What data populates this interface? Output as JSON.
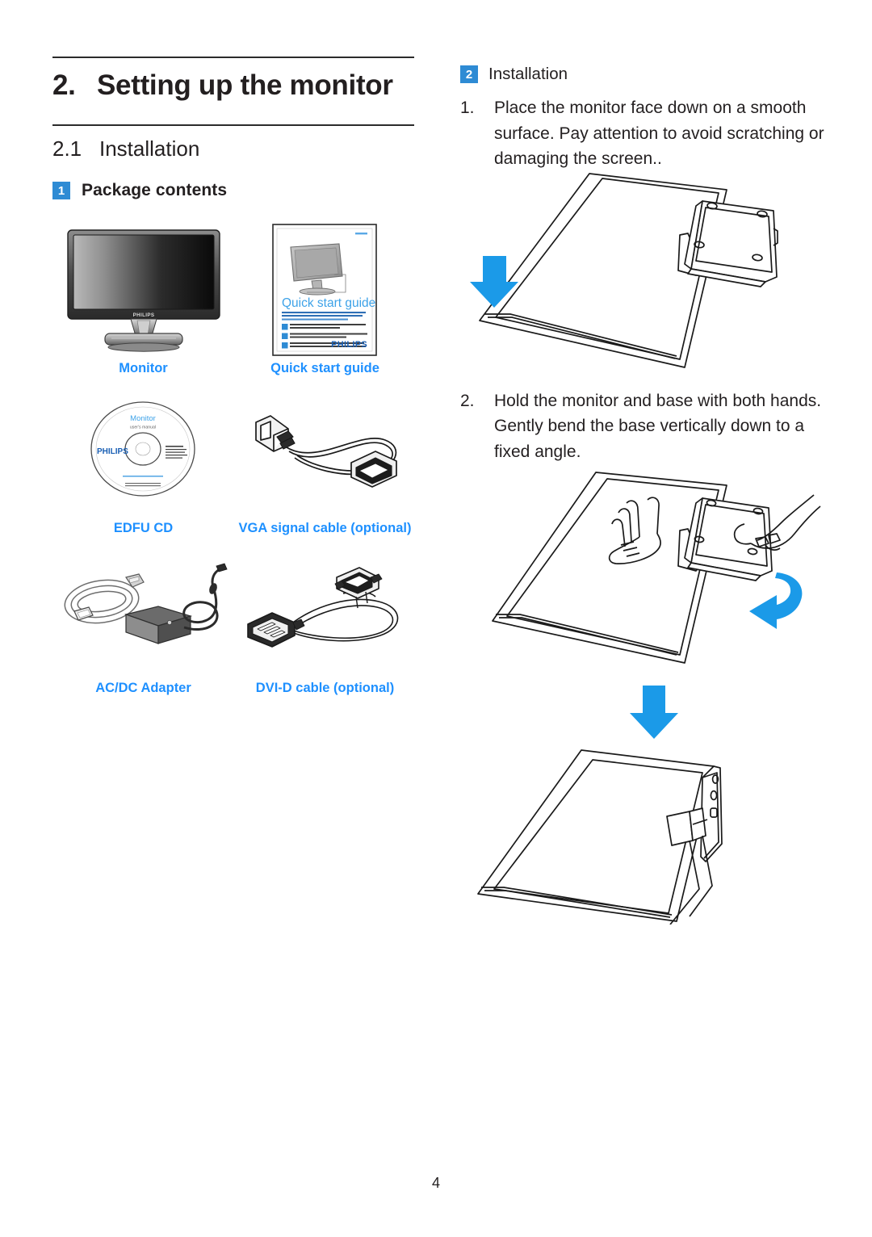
{
  "document": {
    "page_number": "4"
  },
  "left": {
    "chapter_number": "2.",
    "chapter_title": "Setting up the monitor",
    "section_number": "2.1",
    "section_title": "Installation",
    "subsection_badge": "1",
    "subsection_title": "Package contents",
    "items": [
      {
        "caption": "Monitor",
        "icon": "monitor-illustration"
      },
      {
        "caption": "Quick start guide",
        "icon": "quick-start-guide-illustration"
      },
      {
        "caption": "EDFU CD",
        "icon": "cd-disc-illustration"
      },
      {
        "caption": "VGA signal cable (optional)",
        "icon": "vga-cable-illustration"
      },
      {
        "caption": "AC/DC Adapter",
        "icon": "ac-dc-adapter-illustration"
      },
      {
        "caption": "DVI-D cable (optional)",
        "icon": "dvi-d-cable-illustration"
      }
    ],
    "monitor_art": {
      "brand": "PHILIPS"
    },
    "guide_art": {
      "title": "Quick start guide",
      "brand": "PHILIPS",
      "badges": [
        "1",
        "2",
        "3"
      ]
    },
    "cd_art": {
      "title": "Monitor",
      "subtitle": "user's manual",
      "brand": "PHILIPS"
    }
  },
  "right": {
    "badge": "2",
    "heading": "Installation",
    "steps": [
      {
        "number": "1.",
        "text": "Place the monitor face down on a smooth surface. Pay attention to avoid scratching or damaging the screen.."
      },
      {
        "number": "2.",
        "text": "Hold the monitor and base with both hands. Gently bend the base vertically down to a fixed angle."
      }
    ],
    "figures": [
      {
        "name": "monitor-face-down-figure"
      },
      {
        "name": "hands-bending-base-figure"
      },
      {
        "name": "folded-base-figure"
      }
    ]
  },
  "colors": {
    "accent_blue": "#1e90ff",
    "badge_blue": "#2e8bd4",
    "arrow_blue": "#1b9ae8",
    "text": "#231f20"
  }
}
